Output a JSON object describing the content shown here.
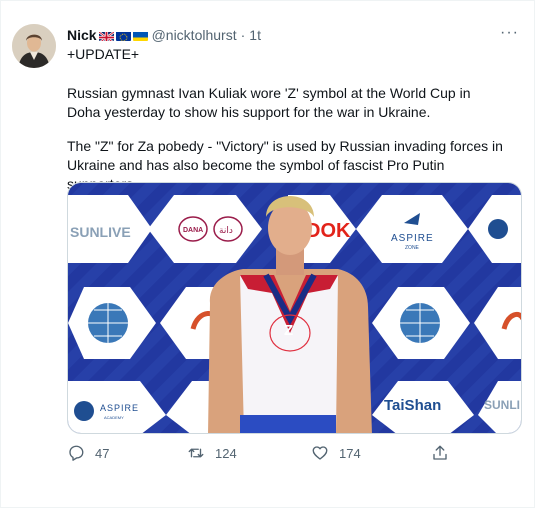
{
  "tweet": {
    "display_name": "Nick",
    "handle": "@nicktolhurst",
    "separator": "·",
    "time": "1t",
    "more_label": "···",
    "line1": "+UPDATE+",
    "paragraph1": "Russian gymnast Ivan Kuliak wore 'Z' symbol at the World Cup in Doha yesterday to show his support for the war in Ukraine.",
    "paragraph2": "The \"Z\" for Za pobedy - \"Victory\" is used by Russian invading forces in Ukraine and has also become the symbol of fascist Pro Putin supporters."
  },
  "media": {
    "sponsors": {
      "sunlive": "SUNLIVE",
      "dana": "DANA",
      "dana_ar": "دانة",
      "dok": "DOK",
      "aspire": "ASPIRE",
      "aspire_sub": "ZONE",
      "aspire_academy": "ASPIRE",
      "academy": "ACADEMY",
      "taishan": "TaiShan",
      "sunlive2": "SUNLI"
    },
    "shirt_symbol": "Z"
  },
  "actions": {
    "replies": "47",
    "retweets": "124",
    "likes": "174"
  },
  "colors": {
    "text": "#0f1419",
    "secondary": "#536471",
    "backdrop": "#243da0",
    "annotation": "#e03040"
  },
  "icons": [
    "reply-icon",
    "retweet-icon",
    "like-icon",
    "share-icon",
    "more-icon",
    "uk-flag-icon",
    "eu-flag-icon",
    "ukraine-flag-icon"
  ]
}
